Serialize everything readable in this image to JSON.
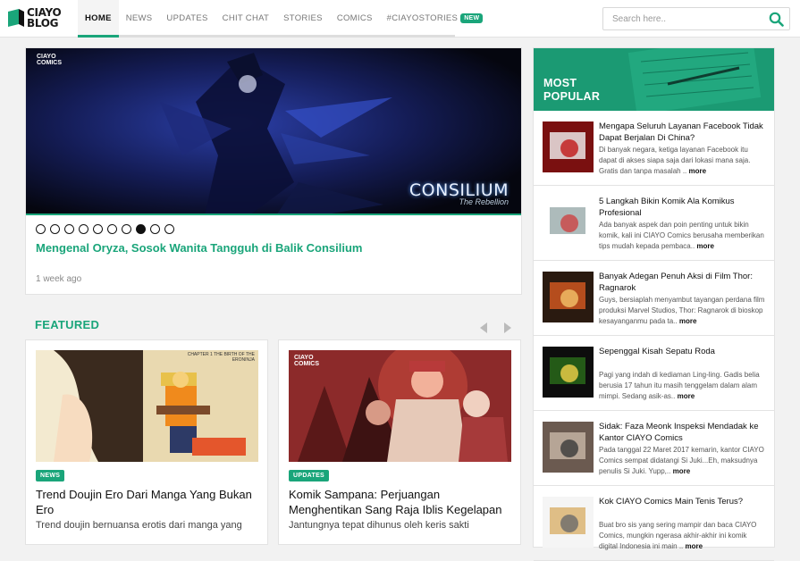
{
  "header": {
    "logo_line1": "CIAYO",
    "logo_line2": "BLOG",
    "nav": [
      {
        "label": "HOME"
      },
      {
        "label": "NEWS"
      },
      {
        "label": "UPDATES"
      },
      {
        "label": "CHIT CHAT"
      },
      {
        "label": "STORIES"
      },
      {
        "label": "COMICS"
      },
      {
        "label": "#CIAYOSTORIES",
        "badge": "NEW"
      }
    ],
    "search_placeholder": "Search here.."
  },
  "hero": {
    "image_logo_line1": "CIAYO",
    "image_logo_line2": "COMICS",
    "image_brand": "CONSILIUM",
    "image_brand_sub": "The Rebellion",
    "title": "Mengenal Oryza, Sosok Wanita Tangguh di Balik Consilium",
    "time": "1 week ago",
    "slide_total": 10,
    "slide_active": 8
  },
  "featured": {
    "heading": "FEATURED",
    "cards": [
      {
        "tag": "NEWS",
        "title": "Trend Doujin Ero Dari Manga Yang Bukan Ero",
        "excerpt": "Trend doujin bernuansa erotis dari manga yang",
        "img_caption": "CHAPTER 1 THE BIRTH OF THE ERONINJA"
      },
      {
        "tag": "UPDATES",
        "title": "Komik Sampana: Perjuangan Menghentikan Sang Raja Iblis Kegelapan",
        "excerpt": "Jantungnya tepat dihunus oleh keris sakti",
        "img_logo_line1": "CIAYO",
        "img_logo_line2": "COMICS"
      }
    ]
  },
  "popular": {
    "heading_line1": "MOST",
    "heading_line2": "POPULAR",
    "items": [
      {
        "title": "Mengapa Seluruh Layanan Facebook Tidak Dapat Berjalan Di China?",
        "excerpt": "Di banyak negara, ketiga layanan Facebook itu dapat di akses siapa saja dari lokasi mana saja. Gratis dan tanpa masalah ..",
        "more": "more"
      },
      {
        "title": "5 Langkah Bikin Komik Ala Komikus Profesional",
        "excerpt": "Ada banyak aspek dan poin penting untuk bikin komik, kali ini CIAYO Comics berusaha memberikan tips mudah kepada pembaca..",
        "more": "more"
      },
      {
        "title": "Banyak Adegan Penuh Aksi di Film Thor: Ragnarok",
        "excerpt": "Guys, bersiaplah menyambut tayangan perdana film produksi Marvel Studios, Thor: Ragnarok di bioskop kesayanganmu pada ta..",
        "more": "more"
      },
      {
        "title": "Sepenggal Kisah Sepatu Roda",
        "excerpt": "Pagi yang indah di kediaman Ling-ling. Gadis belia berusia 17 tahun itu masih tenggelam dalam alam mimpi. Sedang asik-as..",
        "more": "more"
      },
      {
        "title": "Sidak: Faza Meonk Inspeksi Mendadak ke Kantor CIAYO Comics",
        "excerpt": "Pada tanggal 22 Maret 2017 kemarin, kantor CIAYO Comics sempat didatangi Si Juki...Eh, maksudnya penulis Si Juki. Yupp,..",
        "more": "more"
      },
      {
        "title": "Kok CIAYO Comics Main Tenis Terus?",
        "excerpt": "Buat bro sis yang sering mampir dan baca CIAYO Comics, mungkin ngerasa akhir-akhir ini komik digital Indonesia ini main ..",
        "more": "more"
      }
    ]
  },
  "colors": {
    "accent": "#1aa57a",
    "popular_bg": "#1b9a73"
  }
}
